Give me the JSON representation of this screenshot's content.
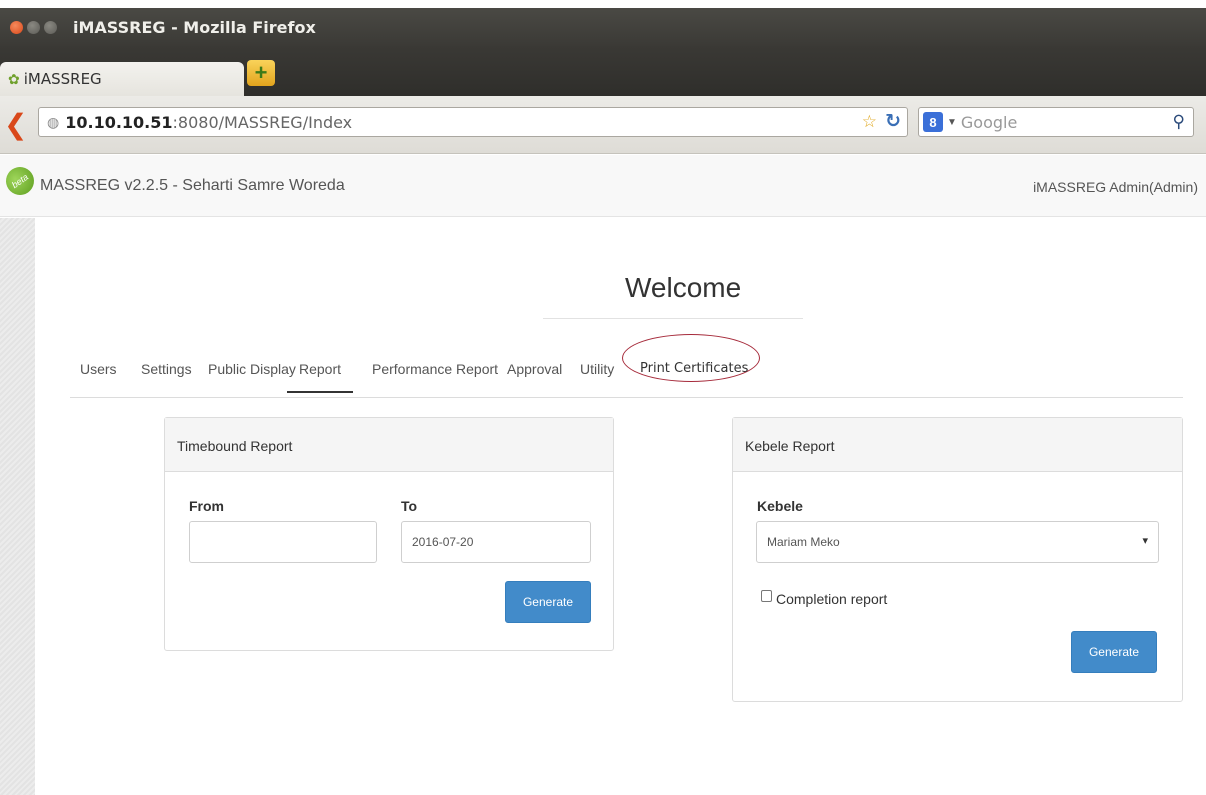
{
  "window": {
    "title": "iMASSREG - Mozilla Firefox"
  },
  "browser": {
    "tab_label": "iMASSREG",
    "url_host": "10.10.10.51",
    "url_path": ":8080/MASSREG/Index",
    "search_placeholder": "Google"
  },
  "header": {
    "badge": "beta",
    "app_title": "MASSREG v2.2.5 - Seharti Samre Woreda",
    "user": "iMASSREG Admin(Admin)"
  },
  "page": {
    "heading": "Welcome",
    "tabs": [
      {
        "label": "Users"
      },
      {
        "label": "Settings"
      },
      {
        "label": "Public Display"
      },
      {
        "label": "Report"
      },
      {
        "label": "Performance Report"
      },
      {
        "label": "Approval"
      },
      {
        "label": "Utility"
      },
      {
        "label": "Print Certificates"
      }
    ],
    "active_tab": "Report"
  },
  "timebound": {
    "title": "Timebound Report",
    "from_label": "From",
    "from_value": "",
    "to_label": "To",
    "to_value": "2016-07-20",
    "button": "Generate"
  },
  "kebele": {
    "title": "Kebele Report",
    "field_label": "Kebele",
    "selected": "Mariam Meko",
    "checkbox_label": "Completion report",
    "checkbox_checked": false,
    "button": "Generate"
  },
  "colors": {
    "primary_button": "#428bca",
    "highlight_ellipse": "#a62b3b"
  }
}
